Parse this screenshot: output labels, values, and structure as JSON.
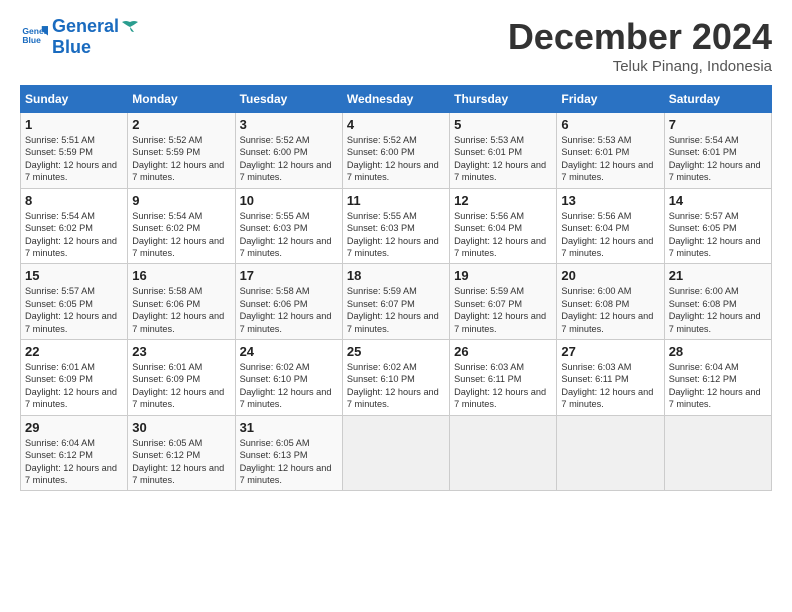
{
  "header": {
    "logo_line1": "General",
    "logo_line2": "Blue",
    "month": "December 2024",
    "location": "Teluk Pinang, Indonesia"
  },
  "weekdays": [
    "Sunday",
    "Monday",
    "Tuesday",
    "Wednesday",
    "Thursday",
    "Friday",
    "Saturday"
  ],
  "weeks": [
    [
      {
        "day": "1",
        "rise": "5:51 AM",
        "set": "5:59 PM",
        "daylight": "12 hours and 7 minutes."
      },
      {
        "day": "2",
        "rise": "5:52 AM",
        "set": "5:59 PM",
        "daylight": "12 hours and 7 minutes."
      },
      {
        "day": "3",
        "rise": "5:52 AM",
        "set": "6:00 PM",
        "daylight": "12 hours and 7 minutes."
      },
      {
        "day": "4",
        "rise": "5:52 AM",
        "set": "6:00 PM",
        "daylight": "12 hours and 7 minutes."
      },
      {
        "day": "5",
        "rise": "5:53 AM",
        "set": "6:01 PM",
        "daylight": "12 hours and 7 minutes."
      },
      {
        "day": "6",
        "rise": "5:53 AM",
        "set": "6:01 PM",
        "daylight": "12 hours and 7 minutes."
      },
      {
        "day": "7",
        "rise": "5:54 AM",
        "set": "6:01 PM",
        "daylight": "12 hours and 7 minutes."
      }
    ],
    [
      {
        "day": "8",
        "rise": "5:54 AM",
        "set": "6:02 PM",
        "daylight": "12 hours and 7 minutes."
      },
      {
        "day": "9",
        "rise": "5:54 AM",
        "set": "6:02 PM",
        "daylight": "12 hours and 7 minutes."
      },
      {
        "day": "10",
        "rise": "5:55 AM",
        "set": "6:03 PM",
        "daylight": "12 hours and 7 minutes."
      },
      {
        "day": "11",
        "rise": "5:55 AM",
        "set": "6:03 PM",
        "daylight": "12 hours and 7 minutes."
      },
      {
        "day": "12",
        "rise": "5:56 AM",
        "set": "6:04 PM",
        "daylight": "12 hours and 7 minutes."
      },
      {
        "day": "13",
        "rise": "5:56 AM",
        "set": "6:04 PM",
        "daylight": "12 hours and 7 minutes."
      },
      {
        "day": "14",
        "rise": "5:57 AM",
        "set": "6:05 PM",
        "daylight": "12 hours and 7 minutes."
      }
    ],
    [
      {
        "day": "15",
        "rise": "5:57 AM",
        "set": "6:05 PM",
        "daylight": "12 hours and 7 minutes."
      },
      {
        "day": "16",
        "rise": "5:58 AM",
        "set": "6:06 PM",
        "daylight": "12 hours and 7 minutes."
      },
      {
        "day": "17",
        "rise": "5:58 AM",
        "set": "6:06 PM",
        "daylight": "12 hours and 7 minutes."
      },
      {
        "day": "18",
        "rise": "5:59 AM",
        "set": "6:07 PM",
        "daylight": "12 hours and 7 minutes."
      },
      {
        "day": "19",
        "rise": "5:59 AM",
        "set": "6:07 PM",
        "daylight": "12 hours and 7 minutes."
      },
      {
        "day": "20",
        "rise": "6:00 AM",
        "set": "6:08 PM",
        "daylight": "12 hours and 7 minutes."
      },
      {
        "day": "21",
        "rise": "6:00 AM",
        "set": "6:08 PM",
        "daylight": "12 hours and 7 minutes."
      }
    ],
    [
      {
        "day": "22",
        "rise": "6:01 AM",
        "set": "6:09 PM",
        "daylight": "12 hours and 7 minutes."
      },
      {
        "day": "23",
        "rise": "6:01 AM",
        "set": "6:09 PM",
        "daylight": "12 hours and 7 minutes."
      },
      {
        "day": "24",
        "rise": "6:02 AM",
        "set": "6:10 PM",
        "daylight": "12 hours and 7 minutes."
      },
      {
        "day": "25",
        "rise": "6:02 AM",
        "set": "6:10 PM",
        "daylight": "12 hours and 7 minutes."
      },
      {
        "day": "26",
        "rise": "6:03 AM",
        "set": "6:11 PM",
        "daylight": "12 hours and 7 minutes."
      },
      {
        "day": "27",
        "rise": "6:03 AM",
        "set": "6:11 PM",
        "daylight": "12 hours and 7 minutes."
      },
      {
        "day": "28",
        "rise": "6:04 AM",
        "set": "6:12 PM",
        "daylight": "12 hours and 7 minutes."
      }
    ],
    [
      {
        "day": "29",
        "rise": "6:04 AM",
        "set": "6:12 PM",
        "daylight": "12 hours and 7 minutes."
      },
      {
        "day": "30",
        "rise": "6:05 AM",
        "set": "6:12 PM",
        "daylight": "12 hours and 7 minutes."
      },
      {
        "day": "31",
        "rise": "6:05 AM",
        "set": "6:13 PM",
        "daylight": "12 hours and 7 minutes."
      },
      {
        "day": "",
        "rise": "",
        "set": "",
        "daylight": ""
      },
      {
        "day": "",
        "rise": "",
        "set": "",
        "daylight": ""
      },
      {
        "day": "",
        "rise": "",
        "set": "",
        "daylight": ""
      },
      {
        "day": "",
        "rise": "",
        "set": "",
        "daylight": ""
      }
    ]
  ]
}
